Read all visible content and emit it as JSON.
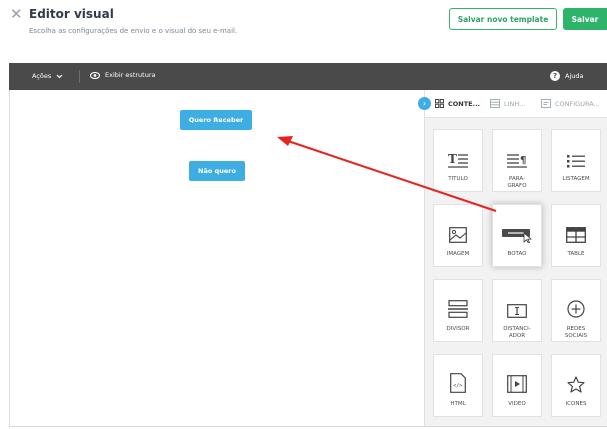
{
  "header": {
    "close_icon": "close-icon",
    "title": "Editor visual",
    "subtitle": "Escolha as configurações de envio e o visual do seu e-mail.",
    "save_template_label": "Salvar novo template",
    "save_label": "Salvar",
    "accent_color": "#2eb46a"
  },
  "toolbar": {
    "acoes_label": "Ações",
    "estrutura_label": "Exibir estrutura",
    "ajuda_label": "Ajuda"
  },
  "canvas": {
    "buttons": [
      {
        "label": "Quero Receber"
      },
      {
        "label": "Não quero"
      }
    ],
    "button_color": "#3eaee2"
  },
  "panel": {
    "tabs": [
      {
        "label": "CONTE...",
        "icon": "grid-icon",
        "active": true
      },
      {
        "label": "LINH...",
        "icon": "rows-icon",
        "active": false
      },
      {
        "label": "CONFIGURA...",
        "icon": "settings-icon",
        "active": false
      }
    ],
    "tiles": [
      {
        "label": "TITULO",
        "icon": "title-icon"
      },
      {
        "label": "PARA-\nGRAFO",
        "icon": "paragraph-icon"
      },
      {
        "label": "LISTAGEM",
        "icon": "list-icon"
      },
      {
        "label": "IMAGEM",
        "icon": "image-icon"
      },
      {
        "label": "BOTAO",
        "icon": "button-icon"
      },
      {
        "label": "TABLE",
        "icon": "table-icon"
      },
      {
        "label": "DIVISOR",
        "icon": "divider-icon"
      },
      {
        "label": "DISTANCI-\nADOR",
        "icon": "spacer-icon"
      },
      {
        "label": "REDES\nSOCIAIS",
        "icon": "social-icon"
      },
      {
        "label": "HTML",
        "icon": "html-icon"
      },
      {
        "label": "VIDEO",
        "icon": "video-icon"
      },
      {
        "label": "ICONES",
        "icon": "star-icon"
      }
    ]
  },
  "annotation": {
    "arrow_color": "#e8231f"
  }
}
